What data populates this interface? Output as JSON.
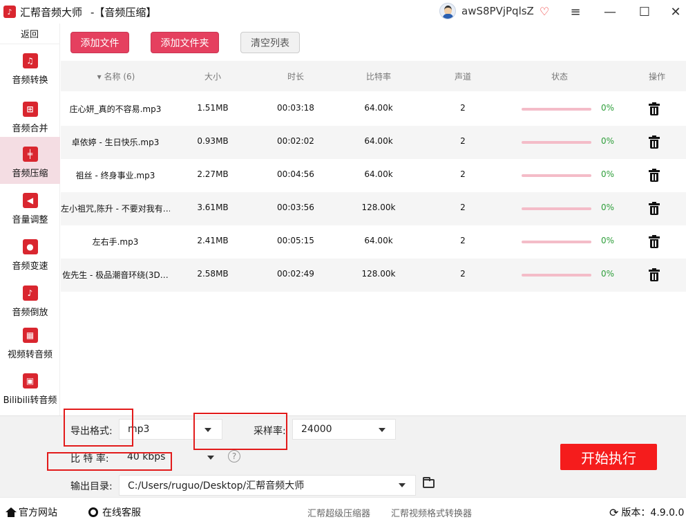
{
  "window": {
    "app_title": "汇帮音频大师",
    "page_title": "-【音频压缩】",
    "username": "awS8PVjPqlsZ"
  },
  "sidebar": {
    "back_label": "返回",
    "items": [
      {
        "label": "音频转换",
        "icon": "audio-convert-icon",
        "active": false
      },
      {
        "label": "音频合并",
        "icon": "audio-merge-icon",
        "active": false
      },
      {
        "label": "音频压缩",
        "icon": "audio-compress-icon",
        "active": true
      },
      {
        "label": "音量调整",
        "icon": "volume-icon",
        "active": false
      },
      {
        "label": "音频变速",
        "icon": "microphone-icon",
        "active": false
      },
      {
        "label": "音频倒放",
        "icon": "music-note-icon",
        "active": false
      },
      {
        "label": "视频转音频",
        "icon": "film-icon",
        "active": false
      },
      {
        "label": "Bilibili转音频",
        "icon": "bilibili-icon",
        "active": false
      }
    ]
  },
  "toolbar": {
    "add_file": "添加文件",
    "add_folder": "添加文件夹",
    "clear_list": "清空列表"
  },
  "table": {
    "headers": {
      "name": "▾ 名称 (6)",
      "size": "大小",
      "duration": "时长",
      "bitrate": "比特率",
      "channels": "声道",
      "status": "状态",
      "action": "操作"
    },
    "rows": [
      {
        "name": "庄心妍_真的不容易.mp3",
        "size": "1.51MB",
        "duration": "00:03:18",
        "bitrate": "64.00k",
        "channels": "2",
        "progress": "0%"
      },
      {
        "name": "卓依婷 - 生日快乐.mp3",
        "size": "0.93MB",
        "duration": "00:02:02",
        "bitrate": "64.00k",
        "channels": "2",
        "progress": "0%"
      },
      {
        "name": "祖丝 - 终身事业.mp3",
        "size": "2.27MB",
        "duration": "00:04:56",
        "bitrate": "64.00k",
        "channels": "2",
        "progress": "0%"
      },
      {
        "name": "左小祖咒,陈升 - 不要对我有…",
        "size": "3.61MB",
        "duration": "00:03:56",
        "bitrate": "128.00k",
        "channels": "2",
        "progress": "0%"
      },
      {
        "name": "左右手.mp3",
        "size": "2.41MB",
        "duration": "00:05:15",
        "bitrate": "64.00k",
        "channels": "2",
        "progress": "0%"
      },
      {
        "name": "佐先生 - 极品潮音环绕(3D…",
        "size": "2.58MB",
        "duration": "00:02:49",
        "bitrate": "128.00k",
        "channels": "2",
        "progress": "0%"
      }
    ]
  },
  "settings": {
    "format_label": "导出格式:",
    "format_value": "mp3",
    "samplerate_label": "采样率:",
    "samplerate_value": "24000",
    "bitrate_label": "比 特 率:",
    "bitrate_value": "40 kbps",
    "output_label": "输出目录:",
    "output_value": "C:/Users/ruguo/Desktop/汇帮音频大师",
    "start_button": "开始执行"
  },
  "statusbar": {
    "website": "官方网站",
    "support": "在线客服",
    "link1": "汇帮超级压缩器",
    "link2": "汇帮视频格式转换器",
    "version": "版本：4.9.0.0"
  },
  "colors": {
    "brand_red": "#d9262f",
    "button_pink": "#e5405f",
    "start_red": "#f51c1c",
    "progress_green": "#2e9e3a"
  }
}
